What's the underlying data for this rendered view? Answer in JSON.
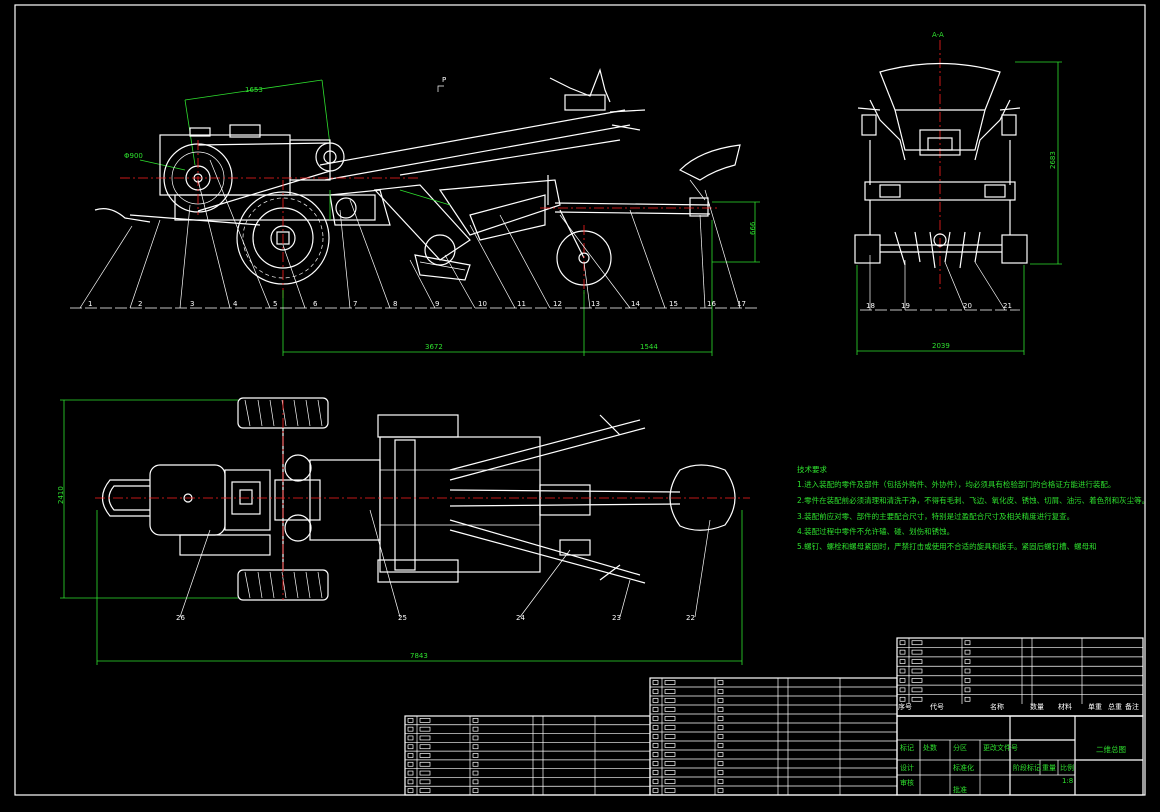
{
  "dimensions": {
    "side_top": "1653",
    "pulley_dia": "Φ900",
    "side_bottom_left": "3672",
    "side_bottom_right": "1544",
    "side_right_height": "666",
    "section_label": "A-A",
    "section_height": "2683",
    "section_width": "2039",
    "plan_width": "7843",
    "plan_height": "2410",
    "p_mark": "P"
  },
  "part_numbers": [
    "1",
    "2",
    "3",
    "4",
    "5",
    "6",
    "7",
    "8",
    "9",
    "10",
    "11",
    "12",
    "13",
    "14",
    "15",
    "16",
    "17"
  ],
  "section_parts": [
    "18",
    "19",
    "20",
    "21"
  ],
  "plan_parts": [
    "26",
    "25",
    "24",
    "23",
    "22"
  ],
  "tech_notes": {
    "title": "技术要求",
    "lines": [
      "1.进入装配的零件及部件（包括外购件、外协件），均必须具有检验部门的合格证方能进行装配。",
      "2.零件在装配前必须清理和清洗干净，不得有毛刺、飞边、氧化皮、锈蚀、切屑、油污、着色剂和灰尘等。",
      "3.装配前应对零、部件的主要配合尺寸，特别是过盈配合尺寸及相关精度进行复查。",
      "4.装配过程中零件不允许磕、碰、划伤和锈蚀。",
      "5.螺钉、螺栓和螺母紧固时，严禁打击或使用不合适的旋具和扳手。紧固后螺钉槽、螺母和"
    ]
  },
  "title_block": {
    "drawing_name": "二维总图",
    "headers": [
      "序号",
      "代号",
      "名称",
      "数量",
      "材料",
      "单重",
      "总重",
      "备注"
    ],
    "small_labels": [
      "标记",
      "处数",
      "分区",
      "更改文件号",
      "签名",
      "年月日",
      "设计",
      "标准化",
      "阶段标记",
      "重量",
      "比例",
      "审核",
      "工艺",
      "批准",
      "共",
      "张",
      "第",
      "张"
    ],
    "scale": "1:8"
  }
}
